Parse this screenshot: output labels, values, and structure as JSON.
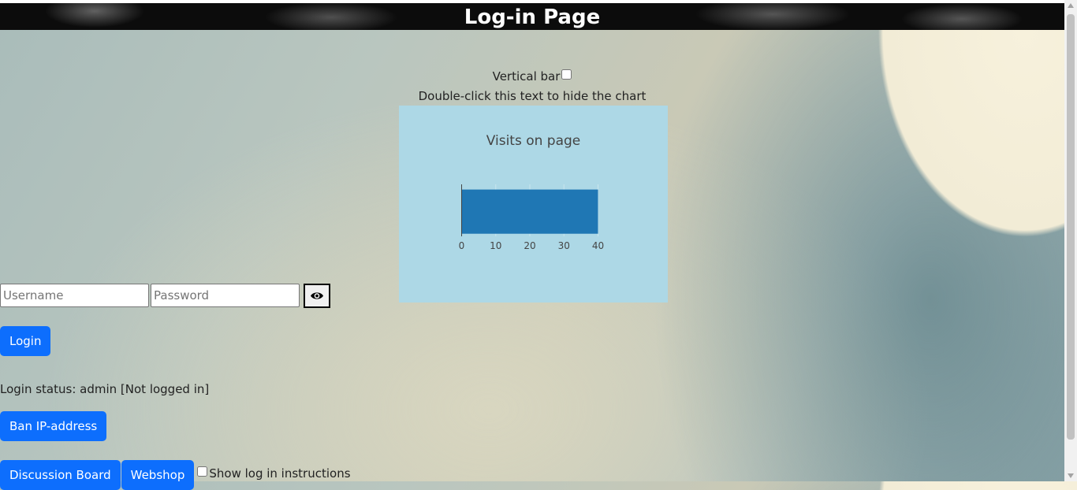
{
  "header": {
    "title": "Log-in Page"
  },
  "chart_controls": {
    "vertical_bar_label": "Vertical bar",
    "hide_hint": "Double-click this text to hide the chart"
  },
  "chart_data": {
    "type": "bar",
    "orientation": "horizontal",
    "title": "Visits on page",
    "categories": [
      ""
    ],
    "values": [
      40
    ],
    "xlim": [
      0,
      40
    ],
    "x_ticks": [
      "0",
      "10",
      "20",
      "30",
      "40"
    ],
    "grid": true,
    "background": "#add8e6",
    "bar_color": "#1f77b4"
  },
  "login": {
    "username_placeholder": "Username",
    "password_placeholder": "Password",
    "toggle_icon": "eye-icon",
    "login_label": "Login",
    "status_text": "Login status: admin [Not logged in]"
  },
  "admin": {
    "ban_label": "Ban IP-address"
  },
  "nav": {
    "discussion_label": "Discussion Board",
    "webshop_label": "Webshop",
    "show_instructions_label": "Show log in instructions"
  },
  "colors": {
    "button": "#0d6efd",
    "header_bg": "#0c0c0c"
  }
}
